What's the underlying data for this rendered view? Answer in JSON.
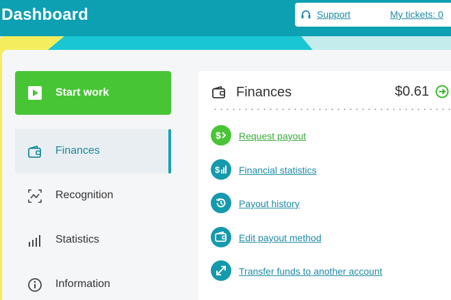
{
  "header": {
    "title": "Dashboard",
    "support_label": "Support",
    "tickets_label": "My tickets: 0"
  },
  "sidebar": {
    "start_work_label": "Start work",
    "items": [
      {
        "label": "Finances",
        "icon": "wallet-icon",
        "active": true
      },
      {
        "label": "Recognition",
        "icon": "recognition-icon",
        "active": false
      },
      {
        "label": "Statistics",
        "icon": "bar-chart-icon",
        "active": false
      },
      {
        "label": "Information",
        "icon": "info-icon",
        "active": false
      }
    ]
  },
  "finances": {
    "title": "Finances",
    "balance": "$0.61",
    "actions": [
      {
        "label": "Request payout",
        "icon": "payout-icon"
      },
      {
        "label": "Financial statistics",
        "icon": "financial-stats-icon"
      },
      {
        "label": "Payout history",
        "icon": "history-icon"
      },
      {
        "label": "Edit payout method",
        "icon": "wallet-icon"
      },
      {
        "label": "Transfer funds to another account",
        "icon": "transfer-icon"
      }
    ]
  },
  "colors": {
    "header": "#0d9fb2",
    "start_button": "#48c535",
    "accent": "#16a2b5",
    "link": "#1d8aa7"
  }
}
